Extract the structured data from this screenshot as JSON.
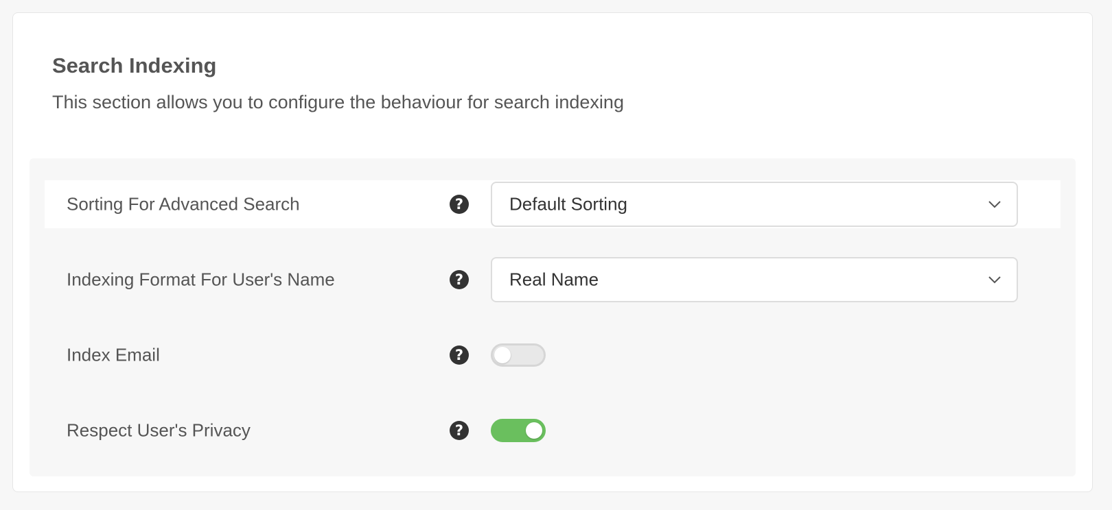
{
  "section": {
    "title": "Search Indexing",
    "description": "This section allows you to configure the behaviour for search indexing"
  },
  "settings": [
    {
      "label": "Sorting For Advanced Search",
      "help_icon": "question-circle-icon",
      "control": "select",
      "value": "Default Sorting"
    },
    {
      "label": "Indexing Format For User's Name",
      "help_icon": "question-circle-icon",
      "control": "select",
      "value": "Real Name"
    },
    {
      "label": "Index Email",
      "help_icon": "question-circle-icon",
      "control": "toggle",
      "enabled": false
    },
    {
      "label": "Respect User's Privacy",
      "help_icon": "question-circle-icon",
      "control": "toggle",
      "enabled": true
    }
  ],
  "colors": {
    "toggle_on": "#6abf5e",
    "toggle_off": "#e8e8e8",
    "help_icon": "#333333"
  },
  "help_glyph": "?"
}
